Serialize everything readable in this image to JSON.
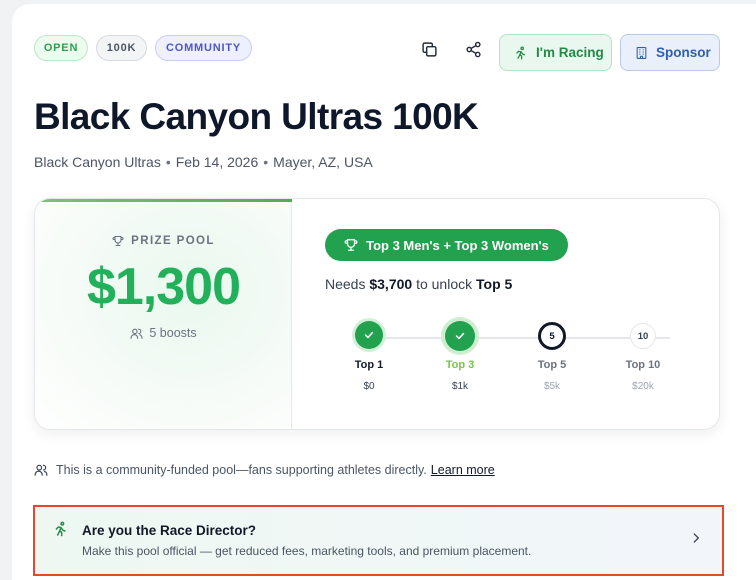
{
  "tags": {
    "open": "OPEN",
    "distance": "100K",
    "community": "COMMUNITY"
  },
  "actions": {
    "racing_label": "I'm Racing",
    "sponsor_label": "Sponsor"
  },
  "race": {
    "title": "Black Canyon Ultras 100K",
    "organizer": "Black Canyon Ultras",
    "date": "Feb 14, 2026",
    "location": "Mayer, AZ, USA"
  },
  "prize_pool": {
    "label": "PRIZE POOL",
    "amount": "$1,300",
    "boosts": "5 boosts",
    "tier_badge": "Top 3 Men's + Top 3 Women's",
    "needs_prefix": "Needs",
    "needs_amount": "$3,700",
    "needs_middle": "to unlock",
    "needs_target": "Top 5",
    "tiers": [
      {
        "label": "Top 1",
        "value": "$0",
        "node_text": "",
        "state": "achieved"
      },
      {
        "label": "Top 3",
        "value": "$1k",
        "node_text": "",
        "state": "current"
      },
      {
        "label": "Top 5",
        "value": "$5k",
        "node_text": "5",
        "state": "next"
      },
      {
        "label": "Top 10",
        "value": "$20k",
        "node_text": "10",
        "state": "locked"
      }
    ]
  },
  "community_note": {
    "text": "This is a community-funded pool—fans supporting athletes directly.",
    "link": "Learn more"
  },
  "race_director": {
    "title": "Are you the Race Director?",
    "subtitle": "Make this pool official — get reduced fees, marketing tools, and premium placement."
  },
  "colors": {
    "accent_green": "#22a24f",
    "prize_green": "#22b05a",
    "highlight_border": "#e24a2a"
  }
}
